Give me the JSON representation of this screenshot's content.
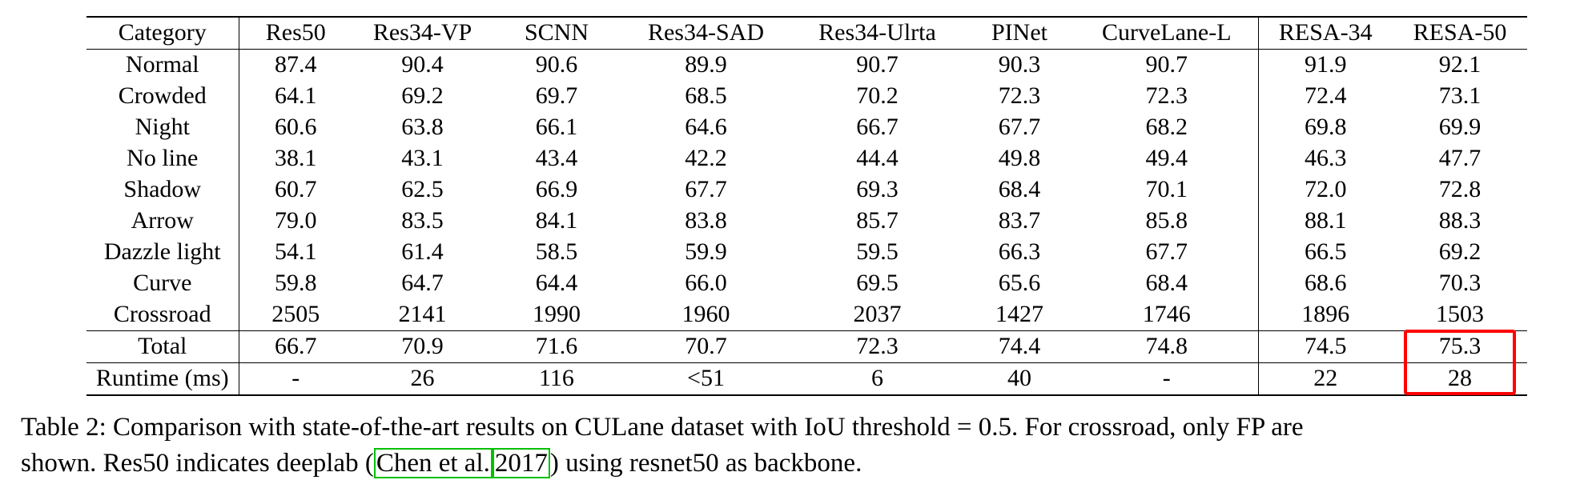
{
  "table": {
    "columns": [
      "Category",
      "Res50",
      "Res34-VP",
      "SCNN",
      "Res34-SAD",
      "Res34-Ulrta",
      "PINet",
      "CurveLane-L",
      "RESA-34",
      "RESA-50"
    ],
    "rows": [
      {
        "category": "Normal",
        "values": [
          "87.4",
          "90.4",
          "90.6",
          "89.9",
          "90.7",
          "90.3",
          "90.7",
          "91.9",
          "92.1"
        ],
        "bold": [
          false,
          false,
          false,
          false,
          false,
          false,
          false,
          false,
          true
        ]
      },
      {
        "category": "Crowded",
        "values": [
          "64.1",
          "69.2",
          "69.7",
          "68.5",
          "70.2",
          "72.3",
          "72.3",
          "72.4",
          "73.1"
        ],
        "bold": [
          false,
          false,
          false,
          false,
          false,
          false,
          false,
          false,
          true
        ]
      },
      {
        "category": "Night",
        "values": [
          "60.6",
          "63.8",
          "66.1",
          "64.6",
          "66.7",
          "67.7",
          "68.2",
          "69.8",
          "69.9"
        ],
        "bold": [
          false,
          false,
          false,
          false,
          false,
          false,
          false,
          false,
          true
        ]
      },
      {
        "category": "No line",
        "values": [
          "38.1",
          "43.1",
          "43.4",
          "42.2",
          "44.4",
          "49.8",
          "49.4",
          "46.3",
          "47.7"
        ],
        "bold": [
          false,
          false,
          false,
          false,
          false,
          true,
          false,
          false,
          false
        ]
      },
      {
        "category": "Shadow",
        "values": [
          "60.7",
          "62.5",
          "66.9",
          "67.7",
          "69.3",
          "68.4",
          "70.1",
          "72.0",
          "72.8"
        ],
        "bold": [
          false,
          false,
          false,
          false,
          false,
          false,
          false,
          false,
          true
        ]
      },
      {
        "category": "Arrow",
        "values": [
          "79.0",
          "83.5",
          "84.1",
          "83.8",
          "85.7",
          "83.7",
          "85.8",
          "88.1",
          "88.3"
        ],
        "bold": [
          false,
          false,
          false,
          false,
          false,
          false,
          false,
          false,
          true
        ]
      },
      {
        "category": "Dazzle light",
        "values": [
          "54.1",
          "61.4",
          "58.5",
          "59.9",
          "59.5",
          "66.3",
          "67.7",
          "66.5",
          "69.2"
        ],
        "bold": [
          false,
          false,
          false,
          false,
          false,
          false,
          false,
          false,
          true
        ]
      },
      {
        "category": "Curve",
        "values": [
          "59.8",
          "64.7",
          "64.4",
          "66.0",
          "69.5",
          "65.6",
          "68.4",
          "68.6",
          "70.3"
        ],
        "bold": [
          false,
          false,
          false,
          false,
          false,
          false,
          false,
          false,
          true
        ]
      },
      {
        "category": "Crossroad",
        "values": [
          "2505",
          "2141",
          "1990",
          "1960",
          "2037",
          "1427",
          "1746",
          "1896",
          "1503"
        ],
        "bold": [
          false,
          false,
          false,
          false,
          false,
          true,
          false,
          false,
          false
        ]
      }
    ],
    "total_row": {
      "category": "Total",
      "values": [
        "66.7",
        "70.9",
        "71.6",
        "70.7",
        "72.3",
        "74.4",
        "74.8",
        "74.5",
        "75.3"
      ],
      "bold": [
        false,
        false,
        false,
        false,
        false,
        false,
        false,
        false,
        true
      ]
    },
    "runtime_row": {
      "category": "Runtime (ms)",
      "values": [
        "-",
        "26",
        "116",
        "<51",
        "6",
        "40",
        "-",
        "22",
        "28"
      ],
      "bold": [
        false,
        false,
        false,
        false,
        false,
        false,
        false,
        false,
        false
      ]
    }
  },
  "annotations": {
    "red_highlight_color": "#ff0000",
    "green_highlight_color": "#00c000",
    "red_boxed_cells": [
      "75.3",
      "28"
    ],
    "green_boxed_text": [
      "Chen et al.",
      "2017"
    ]
  },
  "caption": {
    "line1_a": "Table 2: Comparison with state-of-the-art results on CULane dataset with IoU threshold = 0.5. For crossroad, only FP are",
    "line2_a": "shown. Res50 indicates deeplab (",
    "line2_cite_author": "Chen et al.",
    "line2_cite_year": "2017",
    "line2_b": ") using resnet50 as backbone."
  }
}
